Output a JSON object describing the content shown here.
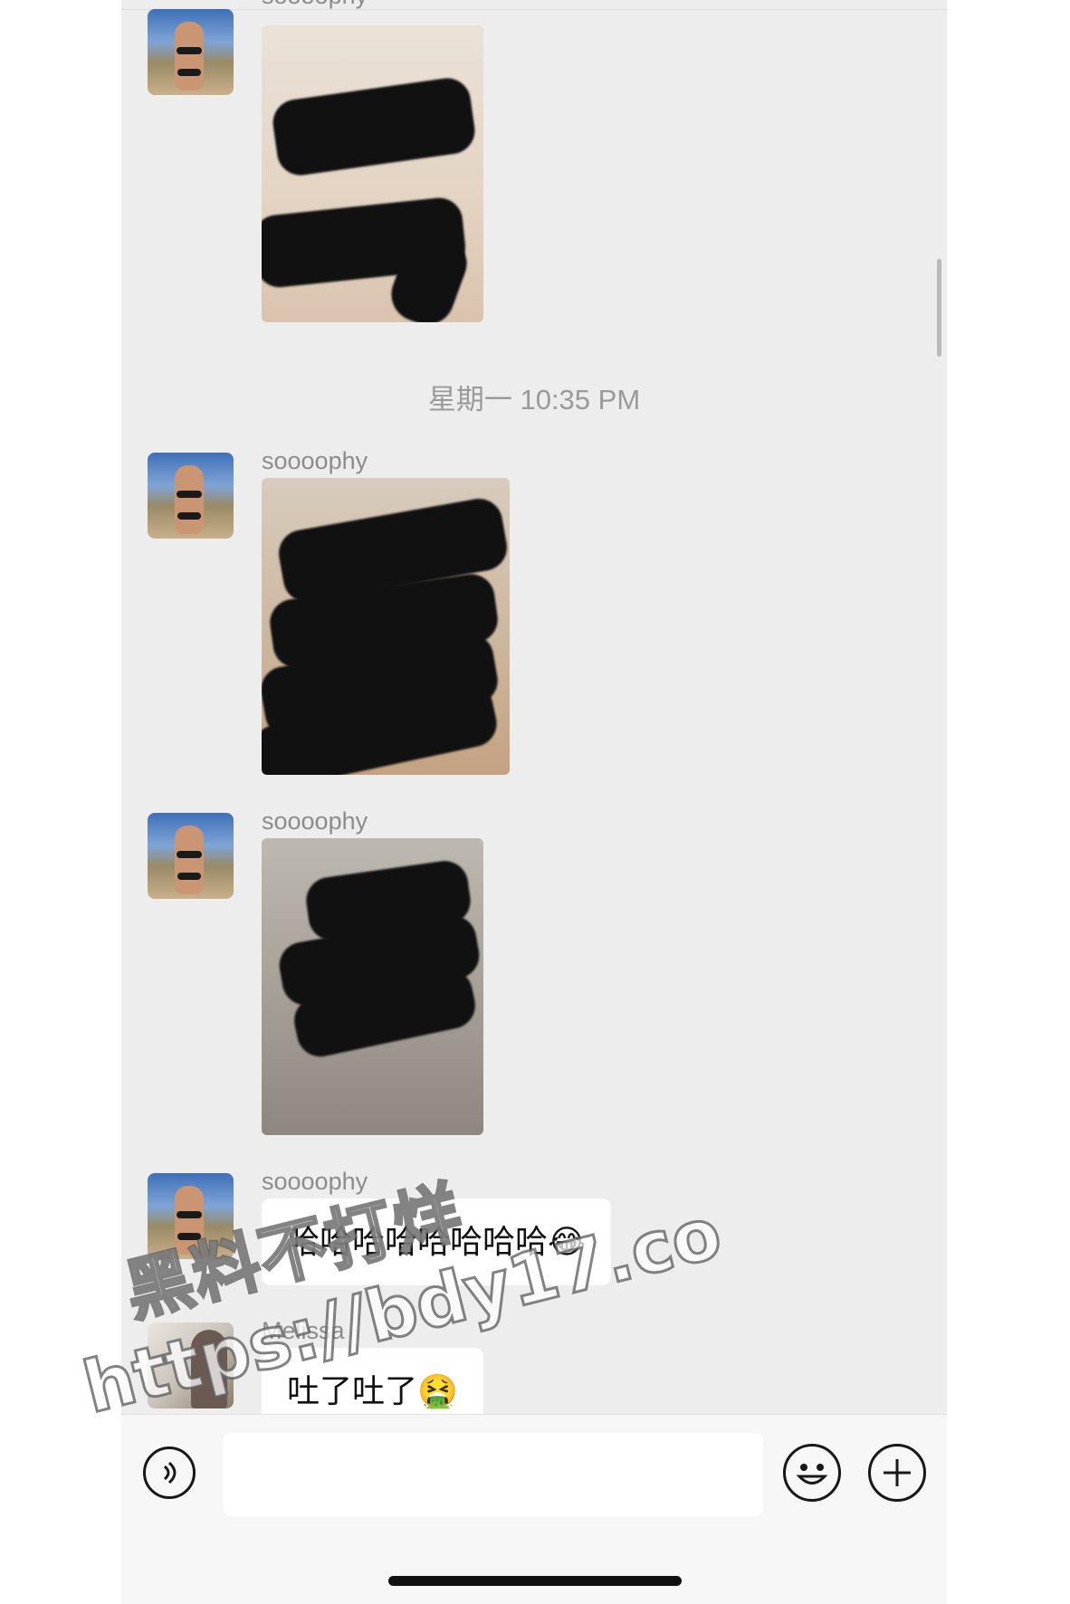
{
  "chat": {
    "timestamp": "星期一 10:35 PM",
    "messages": [
      {
        "sender": "soooophy",
        "type": "image"
      },
      {
        "sender": "soooophy",
        "type": "image"
      },
      {
        "sender": "soooophy",
        "type": "image"
      },
      {
        "sender": "soooophy",
        "type": "text",
        "text": "哈哈哈哈哈哈哈哈😂"
      },
      {
        "sender": "Melissa",
        "type": "text",
        "text": "吐了吐了🤮"
      }
    ]
  },
  "input_bar": {
    "voice_icon": "voice-icon",
    "emoji_icon": "emoji-icon",
    "plus_icon": "plus-icon"
  },
  "watermark": {
    "line1": "黑料不打烊",
    "line2": "https://bdy17.co"
  }
}
